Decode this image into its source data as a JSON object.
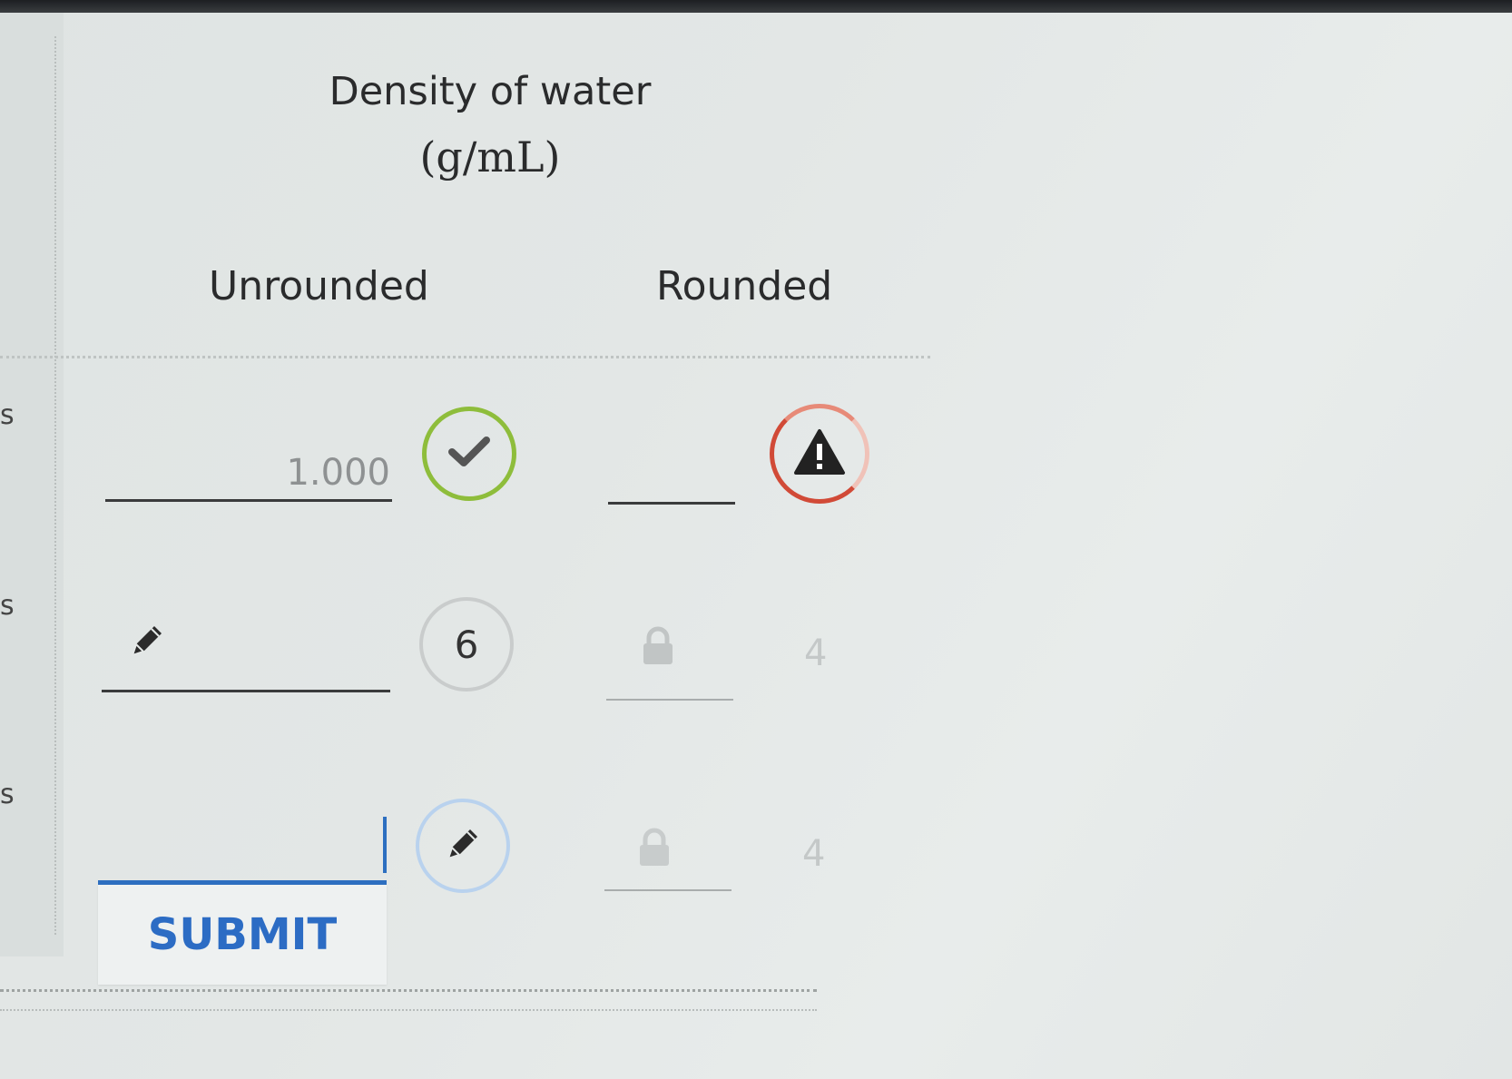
{
  "table": {
    "title": "Density of water",
    "unit": "(g/mL)",
    "columns": [
      "Unrounded",
      "Rounded"
    ]
  },
  "rows": [
    {
      "row_mark": "s",
      "unrounded_value": "1.000",
      "unrounded_status": "correct",
      "rounded_value": "",
      "rounded_status": "warning"
    },
    {
      "row_mark": "s",
      "unrounded_value": "",
      "unrounded_status": "edit",
      "unrounded_count": "6",
      "rounded_value": "",
      "rounded_status": "locked",
      "rounded_count": "4"
    },
    {
      "row_mark": "s",
      "unrounded_value": "",
      "unrounded_status": "editing",
      "rounded_value": "",
      "rounded_status": "locked",
      "rounded_count": "4"
    }
  ],
  "submit": {
    "label": "SUBMIT"
  },
  "colors": {
    "correct": "#8ebd3b",
    "warning": "#d14a37",
    "active": "#2d6fc0"
  },
  "icons": {
    "correct": "checkmark-icon",
    "warning": "warning-triangle-icon",
    "edit": "pencil-icon",
    "locked": "lock-icon"
  }
}
